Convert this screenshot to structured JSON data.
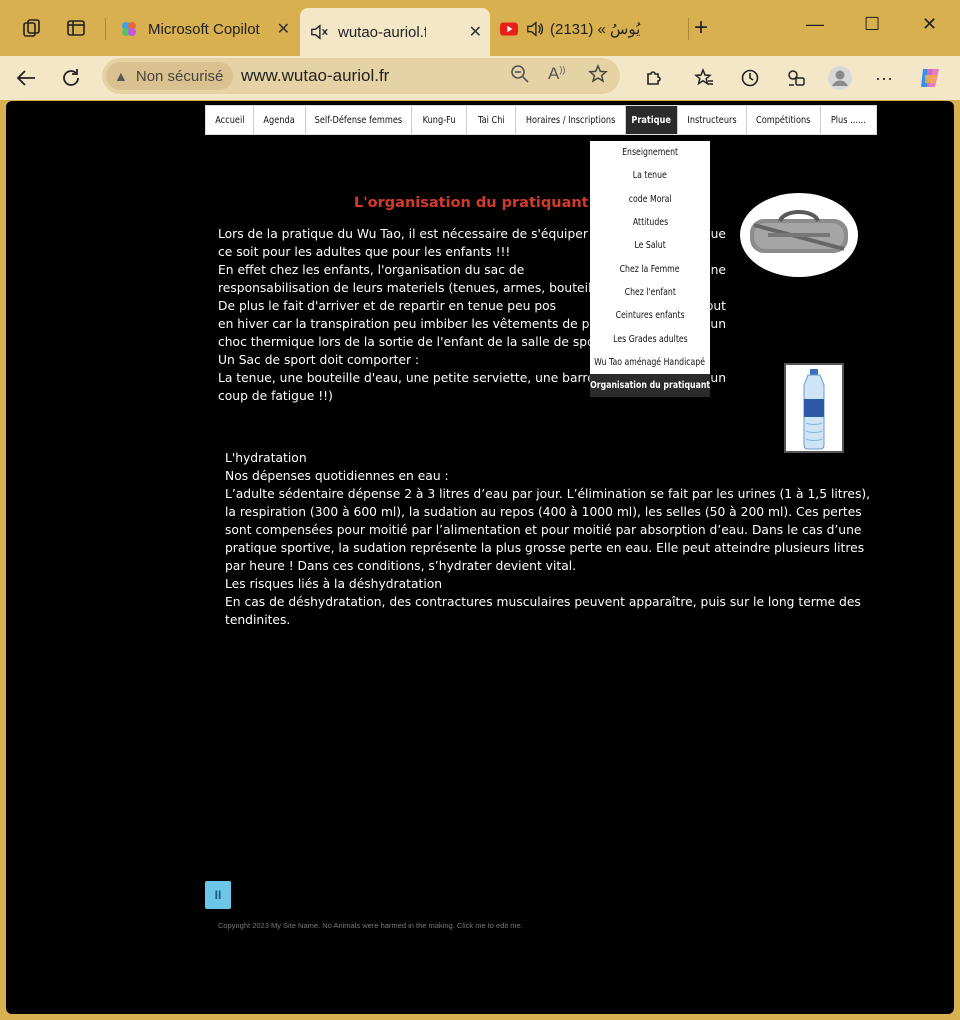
{
  "browser": {
    "tabs": [
      {
        "title": "Microsoft Copilot",
        "active": false
      },
      {
        "title": "wutao-auriol.fr",
        "active": true
      },
      {
        "title": "(2131) « يُوسُ",
        "active": false
      }
    ],
    "new_tab_label": "+",
    "window_controls": {
      "minimize": "—",
      "maximize": "☐",
      "close": "✕"
    },
    "security_label": "Non sécurisé",
    "url": "www.wutao-auriol.fr"
  },
  "site": {
    "menu": [
      {
        "label": "Accueil"
      },
      {
        "label": "Agenda"
      },
      {
        "label": "Self-Défense femmes"
      },
      {
        "label": "Kung-Fu"
      },
      {
        "label": "Tai Chi"
      },
      {
        "label": "Horaires / Inscriptions"
      },
      {
        "label": "Pratique",
        "active": true
      },
      {
        "label": "Instructeurs"
      },
      {
        "label": "Compétitions"
      },
      {
        "label": "Plus ......"
      }
    ],
    "dropdown": [
      "Enseignement",
      "La tenue",
      "code Moral",
      "Attitudes",
      "Le Salut",
      "Chez la Femme",
      "Chez l'enfant",
      "Ceintures enfants",
      "Les Grades adultes",
      "Wu Tao aménagé Handicapé",
      "Organisation du pratiquant"
    ],
    "heading": "L'organisation  du pratiquant",
    "intro_lines": [
      "Lors de la pratique du Wu Tao, il est nécessaire de s'équiper",
      "que",
      "ce soit pour les adultes que pour les enfants !!!",
      "En effet chez les enfants, l'organisation du sac de",
      "une",
      "responsabilisation de leurs materiels (tenues, armes, bouteille",
      "De plus le fait d'arriver et de repartir en tenue peu pos",
      "out",
      "en hiver car la transpiration peu imbiber les vêtements de pra",
      "un",
      "choc thermique lors de la sortie de l'enfant de la salle de spor",
      "Un Sac de sport doit comporter :",
      "La tenue, une bouteille d'eau, une petite serviette, une barre",
      "un",
      "coup de fatigue !!)"
    ],
    "hydration": {
      "title": "L'hydratation",
      "subtitle": "Nos dépenses quotidiennes en eau :",
      "body": "L’adulte sédentaire dépense 2 à 3 litres d’eau par jour. L’élimination se fait par les urines (1 à 1,5 litres), la respiration (300 à 600 ml), la sudation au repos (400 à 1000 ml), les selles (50 à 200 ml). Ces pertes sont compensées pour moitié par l’alimentation et pour moitié par absorption d’eau. Dans le cas d’une pratique sportive, la sudation représente la plus grosse perte en eau. Elle peut atteindre plusieurs litres par heure ! Dans ces conditions, s’hydrater devient vital.",
      "risks_title": "Les risques liés à la déshydratation",
      "risks_body": "En cas de déshydratation, des contractures musculaires peuvent apparaître, puis sur le long terme des tendinites."
    },
    "pause_label": "II",
    "copyright": "Copyright 2023 My Site Name. No Animals were harmed in the making. Click me to edit me."
  }
}
